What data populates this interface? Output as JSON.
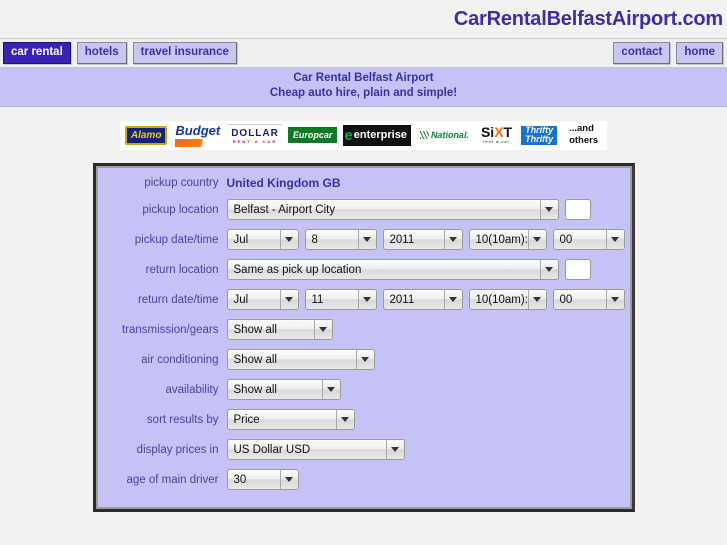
{
  "site": {
    "title": "CarRentalBelfastAirport.com",
    "title_color": "#3b2fa8"
  },
  "nav": {
    "left_items": [
      {
        "label": "car rental",
        "active": true
      },
      {
        "label": "hotels",
        "active": false
      },
      {
        "label": "travel insurance",
        "active": false
      }
    ],
    "right_items": [
      {
        "label": "contact"
      },
      {
        "label": "home"
      }
    ]
  },
  "tagline": {
    "line1": "Car Rental Belfast Airport",
    "line2": "Cheap auto hire, plain and simple!"
  },
  "brands": [
    {
      "name": "Alamo",
      "label": "Alamo",
      "icon": "alamo-logo"
    },
    {
      "name": "Budget",
      "label": "Budget",
      "icon": "budget-logo"
    },
    {
      "name": "Dollar",
      "label": "DOLLAR",
      "sub": "RENT A CAR",
      "icon": "dollar-logo"
    },
    {
      "name": "Europcar",
      "label": "Europcar",
      "icon": "europcar-logo"
    },
    {
      "name": "Enterprise",
      "label": "enterprise",
      "prefix": "e",
      "icon": "enterprise-logo"
    },
    {
      "name": "National",
      "label": "National.",
      "icon": "national-logo"
    },
    {
      "name": "Sixt",
      "label_a": "Si",
      "label_x": "X",
      "label_b": "T",
      "sub": "rent a car",
      "icon": "sixt-logo"
    },
    {
      "name": "Thrifty",
      "label1": "Thrifty",
      "label2": "Thrifty",
      "icon": "thrifty-logo"
    },
    {
      "name": "Others",
      "line1": "...and",
      "line2": "others",
      "icon": "others-label"
    }
  ],
  "form": {
    "rows": {
      "pickup_country": {
        "label": "pickup country",
        "value": "United Kingdom GB"
      },
      "pickup_location": {
        "label": "pickup location",
        "value": "Belfast - Airport City"
      },
      "pickup_datetime": {
        "label": "pickup date/time",
        "month": "Jul",
        "day": "8",
        "year": "2011",
        "hour": "10(10am):",
        "minute": "00"
      },
      "return_location": {
        "label": "return location",
        "value": "Same as pick up location"
      },
      "return_datetime": {
        "label": "return date/time",
        "month": "Jul",
        "day": "11",
        "year": "2011",
        "hour": "10(10am):",
        "minute": "00"
      },
      "transmission": {
        "label": "transmission/gears",
        "value": "Show all"
      },
      "air_conditioning": {
        "label": "air conditioning",
        "value": "Show all"
      },
      "availability": {
        "label": "availability",
        "value": "Show all"
      },
      "sort_results": {
        "label": "sort results by",
        "value": "Price"
      },
      "display_prices": {
        "label": "display prices in",
        "value": "US Dollar USD"
      },
      "driver_age": {
        "label": "age of main driver",
        "value": "30"
      }
    }
  },
  "theme": {
    "panel_bg": "#c5c2f6",
    "label_color": "#4d3fa0",
    "accent": "#3b22b5"
  }
}
